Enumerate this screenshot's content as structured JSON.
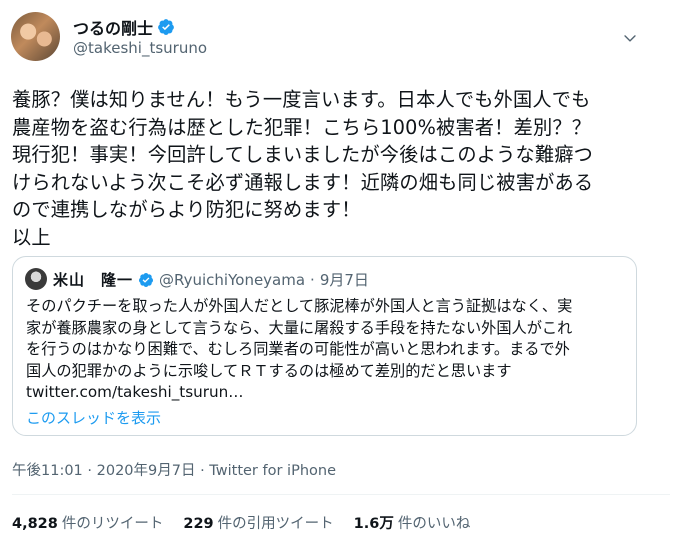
{
  "author": {
    "name": "つるの剛士",
    "handle": "@takeshi_tsuruno"
  },
  "tweet": {
    "text": "養豚？僕は知りません！もう一度言います。日本人でも外国人でも\n農産物を盗む行為は歴とした犯罪！こちら100%被害者！差別？？\n現行犯！事実！今回許してしまいましたが今後はこのような難癖つ\nけられないよう次こそ必ず通報します！近隣の畑も同じ被害がある\nので連携しながらより防犯に努めます！\n以上"
  },
  "quoted": {
    "name": "米山　隆一",
    "handle": "@RyuichiYoneyama",
    "separator": "·",
    "date": "9月7日",
    "text": "そのパクチーを取った人が外国人だとして豚泥棒が外国人と言う証拠はなく、実\n家が養豚農家の身として言うなら、大量に屠殺する手段を持たない外国人がこれ\nを行うのはかなり困難で、むしろ同業者の可能性が高いと思われます。まるで外\n国人の犯罪かのように示唆してＲＴするのは極めて差別的だと思います\ntwitter.com/takeshi_tsurun…",
    "thread_link": "このスレッドを表示"
  },
  "meta": {
    "line": "午後11:01 · 2020年9月7日 · Twitter for iPhone"
  },
  "stats": [
    {
      "num": "4,828",
      "label": "件のリツイート"
    },
    {
      "num": "229",
      "label": "件の引用ツイート"
    },
    {
      "num": "1.6万",
      "label": "件のいいね"
    }
  ],
  "colors": {
    "accent": "#1d9bf0",
    "secondary_text": "#536471",
    "border": "#cfd9de"
  },
  "icons": {
    "verified": "verified-badge-icon",
    "caret": "chevron-down-icon"
  }
}
